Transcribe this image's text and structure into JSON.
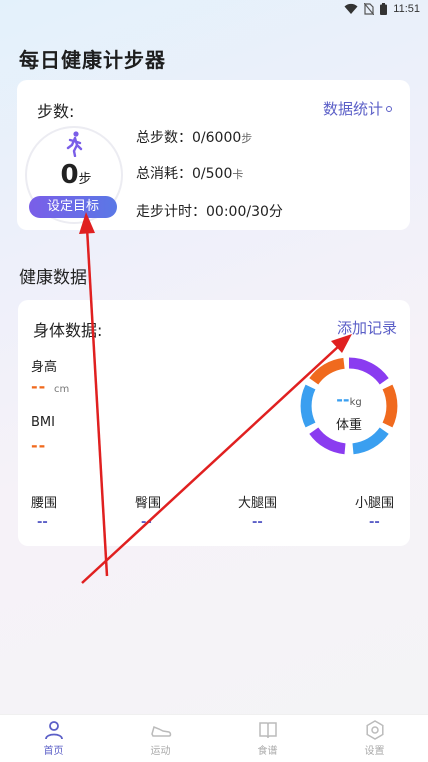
{
  "status_bar": {
    "time": "11:51"
  },
  "app": {
    "title": "每日健康计步器"
  },
  "steps_card": {
    "label": "步数:",
    "stats_link": "数据统计",
    "count": "0",
    "count_unit": "步",
    "goal_button": "设定目标",
    "total_steps_label": "总步数：",
    "total_steps_value": "0/6000",
    "total_steps_unit": "步",
    "calories_label": "总消耗：",
    "calories_value": "0/500",
    "calories_unit": "卡",
    "timer_label": "走步计时：",
    "timer_value": "00:00/30分"
  },
  "health_section": {
    "title": "健康数据"
  },
  "body_card": {
    "label": "身体数据:",
    "add_record": "添加记录",
    "height_label": "身高",
    "height_value": "--",
    "height_unit": "cm",
    "bmi_label": "BMI",
    "bmi_value": "--",
    "weight_value": "--",
    "weight_unit": "kg",
    "weight_label": "体重",
    "girths": [
      {
        "label": "腰围",
        "value": "--"
      },
      {
        "label": "臀围",
        "value": "--"
      },
      {
        "label": "大腿围",
        "value": "--"
      },
      {
        "label": "小腿围",
        "value": "--"
      }
    ]
  },
  "tabs": [
    {
      "label": "首页",
      "icon": "person-icon",
      "active": true
    },
    {
      "label": "运动",
      "icon": "shoe-icon",
      "active": false
    },
    {
      "label": "食谱",
      "icon": "book-icon",
      "active": false
    },
    {
      "label": "设置",
      "icon": "gear-icon",
      "active": false
    }
  ],
  "colors": {
    "accent": "#5b5fc7",
    "orange": "#f06a1e",
    "blue": "#3a9ff0",
    "purple": "#8a3cf0",
    "arrow": "#e02020"
  }
}
